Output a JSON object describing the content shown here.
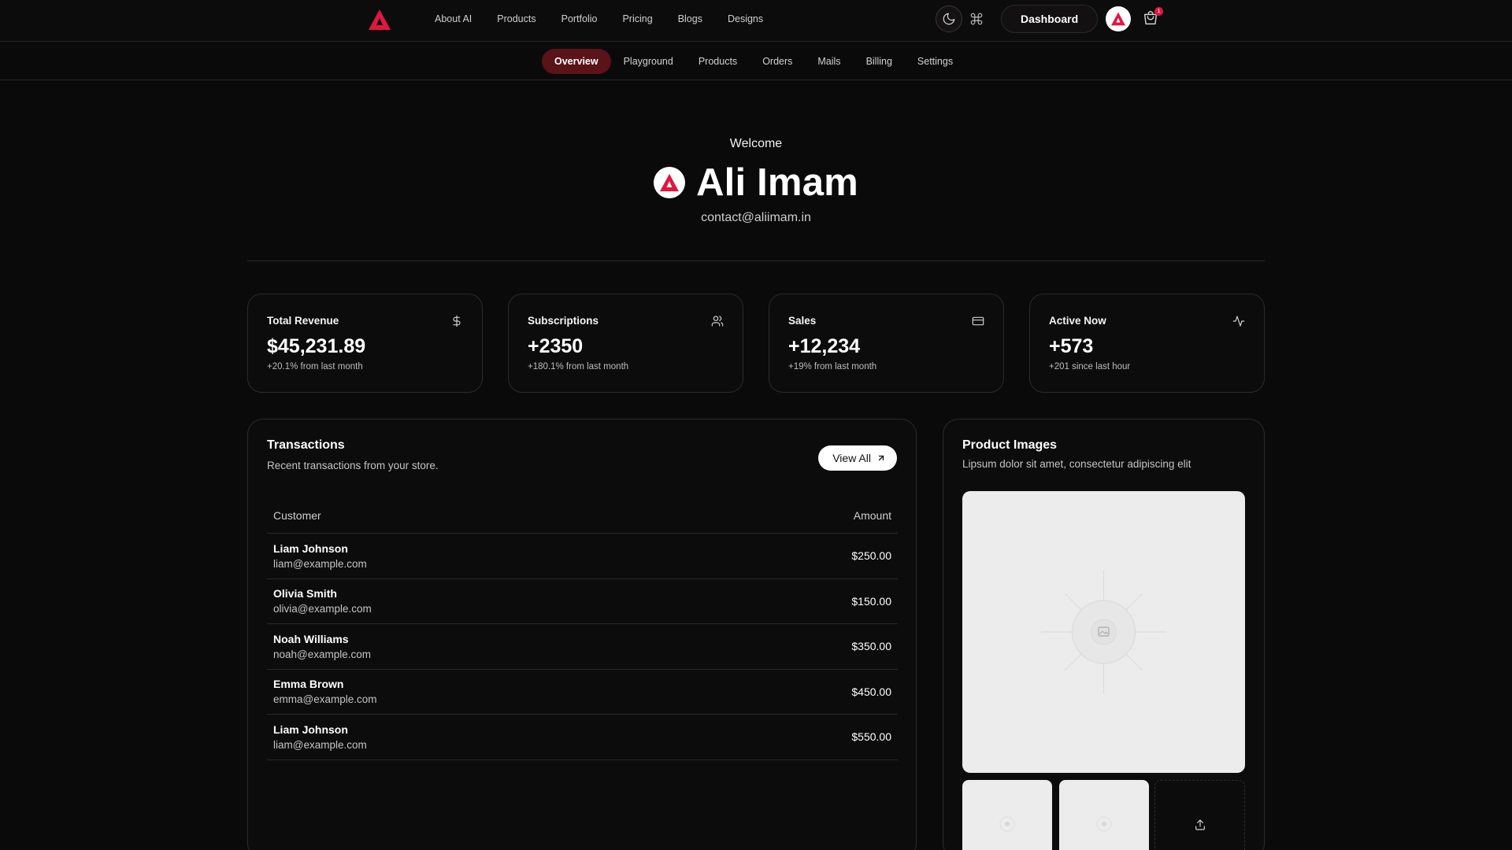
{
  "nav": {
    "links": [
      "About AI",
      "Products",
      "Portfolio",
      "Pricing",
      "Blogs",
      "Designs"
    ],
    "dashboard_label": "Dashboard",
    "cart_count": "1"
  },
  "subnav": {
    "tabs": [
      "Overview",
      "Playground",
      "Products",
      "Orders",
      "Mails",
      "Billing",
      "Settings"
    ],
    "active": "Overview"
  },
  "welcome": {
    "label": "Welcome",
    "name": "Ali Imam",
    "email": "contact@aliimam.in"
  },
  "stats": [
    {
      "title": "Total Revenue",
      "value": "$45,231.89",
      "sub": "+20.1% from last month",
      "icon": "dollar-icon"
    },
    {
      "title": "Subscriptions",
      "value": "+2350",
      "sub": "+180.1% from last month",
      "icon": "users-icon"
    },
    {
      "title": "Sales",
      "value": "+12,234",
      "sub": "+19% from last month",
      "icon": "credit-card-icon"
    },
    {
      "title": "Active Now",
      "value": "+573",
      "sub": "+201 since last hour",
      "icon": "activity-icon"
    }
  ],
  "transactions": {
    "title": "Transactions",
    "description": "Recent transactions from your store.",
    "view_all": "View All",
    "columns": {
      "customer": "Customer",
      "amount": "Amount"
    },
    "rows": [
      {
        "name": "Liam Johnson",
        "email": "liam@example.com",
        "amount": "$250.00"
      },
      {
        "name": "Olivia Smith",
        "email": "olivia@example.com",
        "amount": "$150.00"
      },
      {
        "name": "Noah Williams",
        "email": "noah@example.com",
        "amount": "$350.00"
      },
      {
        "name": "Emma Brown",
        "email": "emma@example.com",
        "amount": "$450.00"
      },
      {
        "name": "Liam Johnson",
        "email": "liam@example.com",
        "amount": "$550.00"
      }
    ]
  },
  "product_images": {
    "title": "Product Images",
    "description": "Lipsum dolor sit amet, consectetur adipiscing elit"
  },
  "colors": {
    "accent": "#e0173f",
    "active_tab_bg": "#5a1318",
    "background": "#0b0a0a"
  }
}
